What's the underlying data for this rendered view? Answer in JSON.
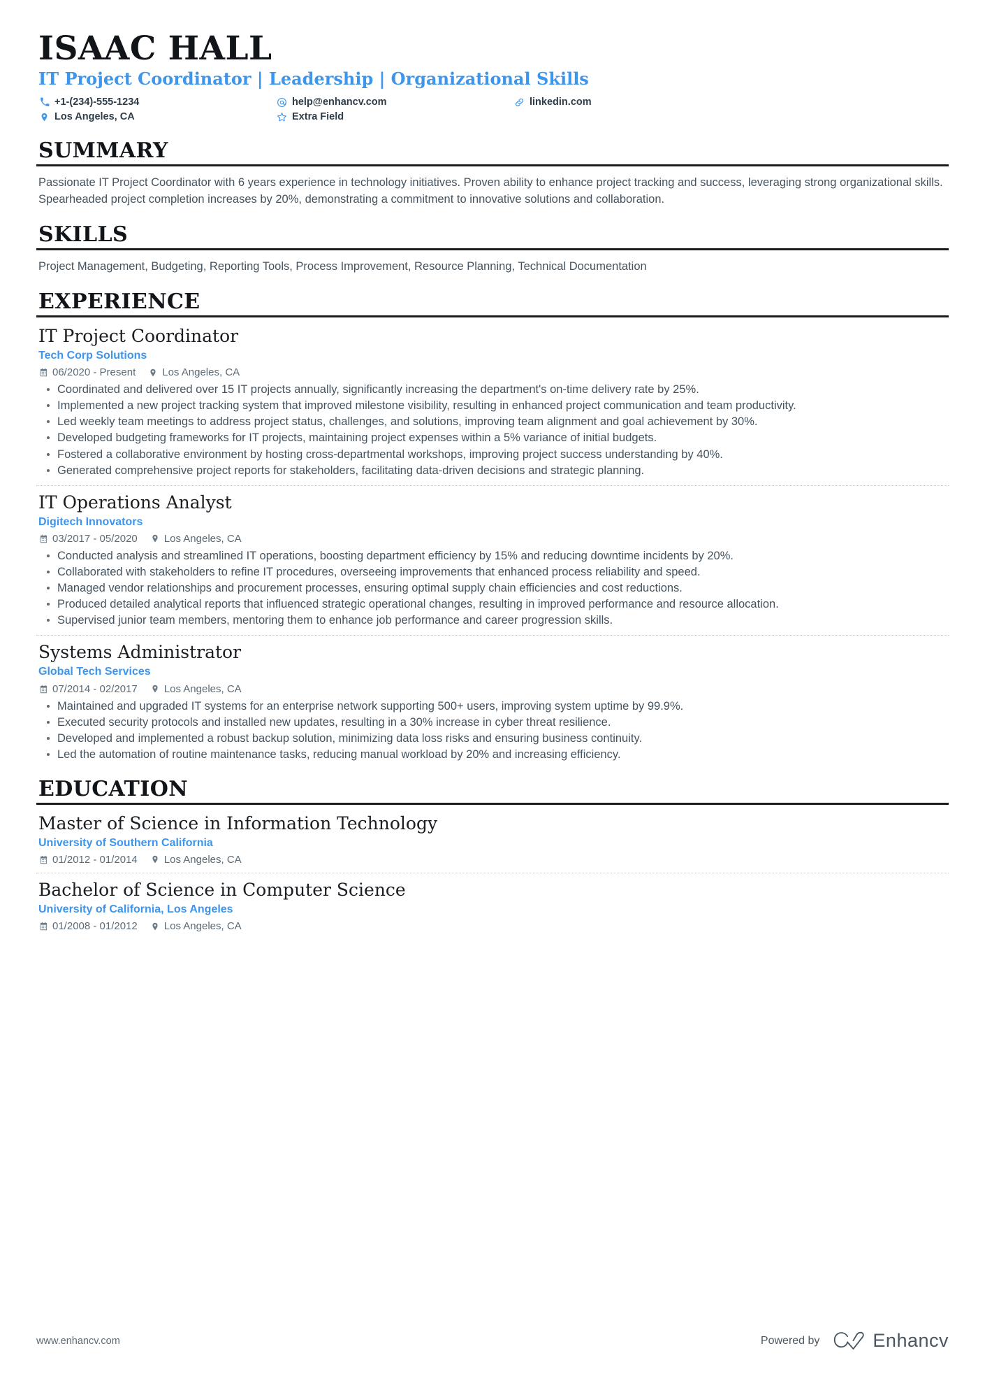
{
  "colors": {
    "accent": "#3d95ec",
    "text": "#44535f",
    "heading": "#111418",
    "rule": "#1c1c1c"
  },
  "header": {
    "name": "ISAAC HALL",
    "headline": "IT Project Coordinator | Leadership | Organizational Skills",
    "contacts": [
      {
        "icon": "phone-icon",
        "label": "+1-(234)-555-1234"
      },
      {
        "icon": "email-icon",
        "label": "help@enhancv.com"
      },
      {
        "icon": "link-icon",
        "label": "linkedin.com"
      },
      {
        "icon": "location-icon",
        "label": "Los Angeles, CA"
      },
      {
        "icon": "star-icon",
        "label": "Extra Field"
      }
    ]
  },
  "summary": {
    "title": "SUMMARY",
    "text": "Passionate IT Project Coordinator with 6 years experience in technology initiatives. Proven ability to enhance project tracking and success, leveraging strong organizational skills. Spearheaded project completion increases by 20%, demonstrating a commitment to innovative solutions and collaboration."
  },
  "skills": {
    "title": "SKILLS",
    "text": "Project Management, Budgeting, Reporting Tools, Process Improvement, Resource Planning, Technical Documentation"
  },
  "experience": {
    "title": "EXPERIENCE",
    "entries": [
      {
        "role": "IT Project Coordinator",
        "company": "Tech Corp Solutions",
        "dates": "06/2020 - Present",
        "location": "Los Angeles, CA",
        "bullets": [
          "Coordinated and delivered over 15 IT projects annually, significantly increasing the department's on-time delivery rate by 25%.",
          "Implemented a new project tracking system that improved milestone visibility, resulting in enhanced project communication and team productivity.",
          "Led weekly team meetings to address project status, challenges, and solutions, improving team alignment and goal achievement by 30%.",
          "Developed budgeting frameworks for IT projects, maintaining project expenses within a 5% variance of initial budgets.",
          "Fostered a collaborative environment by hosting cross-departmental workshops, improving project success understanding by 40%.",
          "Generated comprehensive project reports for stakeholders, facilitating data-driven decisions and strategic planning."
        ]
      },
      {
        "role": "IT Operations Analyst",
        "company": "Digitech Innovators",
        "dates": "03/2017 - 05/2020",
        "location": "Los Angeles, CA",
        "bullets": [
          "Conducted analysis and streamlined IT operations, boosting department efficiency by 15% and reducing downtime incidents by 20%.",
          "Collaborated with stakeholders to refine IT procedures, overseeing improvements that enhanced process reliability and speed.",
          "Managed vendor relationships and procurement processes, ensuring optimal supply chain efficiencies and cost reductions.",
          "Produced detailed analytical reports that influenced strategic operational changes, resulting in improved performance and resource allocation.",
          "Supervised junior team members, mentoring them to enhance job performance and career progression skills."
        ]
      },
      {
        "role": "Systems Administrator",
        "company": "Global Tech Services",
        "dates": "07/2014 - 02/2017",
        "location": "Los Angeles, CA",
        "bullets": [
          "Maintained and upgraded IT systems for an enterprise network supporting 500+ users, improving system uptime by 99.9%.",
          "Executed security protocols and installed new updates, resulting in a 30% increase in cyber threat resilience.",
          "Developed and implemented a robust backup solution, minimizing data loss risks and ensuring business continuity.",
          "Led the automation of routine maintenance tasks, reducing manual workload by 20% and increasing efficiency."
        ]
      }
    ]
  },
  "education": {
    "title": "EDUCATION",
    "entries": [
      {
        "degree": "Master of Science in Information Technology",
        "school": "University of Southern California",
        "dates": "01/2012 - 01/2014",
        "location": "Los Angeles, CA"
      },
      {
        "degree": "Bachelor of Science in Computer Science",
        "school": "University of California, Los Angeles",
        "dates": "01/2008 - 01/2012",
        "location": "Los Angeles, CA"
      }
    ]
  },
  "footer": {
    "url": "www.enhancv.com",
    "powered_by": "Powered by",
    "brand": "Enhancv"
  }
}
